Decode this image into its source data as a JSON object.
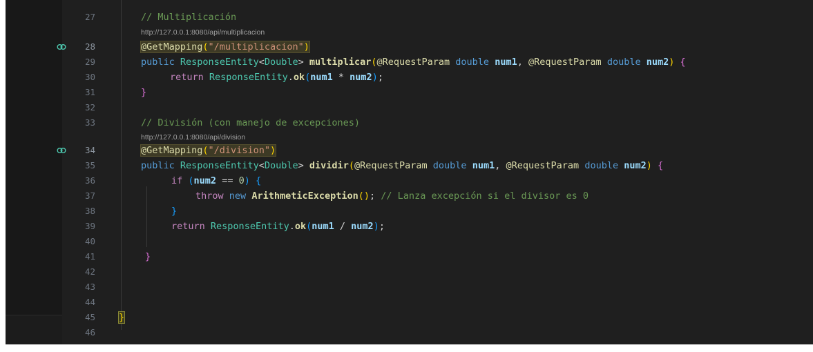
{
  "editor": {
    "codelens": {
      "multiplicacion": "http://127.0.0.1:8080/api/multiplicacion",
      "division": "http://127.0.0.1:8080/api/division"
    },
    "lines": [
      {
        "num": "27",
        "comment": "// Multiplicación"
      },
      {
        "num": "28",
        "annotation": "@GetMapping",
        "open": "(",
        "path": "\"/multiplicacion\"",
        "close": ")"
      },
      {
        "num": "29",
        "public": "public",
        "type": "ResponseEntity",
        "lt": "<",
        "generic": "Double",
        "gt": ">",
        "method": "multiplicar",
        "open": "(",
        "ann1": "@RequestParam",
        "double1": "double",
        "p1": "num1",
        "comma": ",",
        "ann2": "@RequestParam",
        "double2": "double",
        "p2": "num2",
        "close": ")",
        "brace": "{"
      },
      {
        "num": "30",
        "ret": "return",
        "type": "ResponseEntity",
        "dot": ".",
        "method": "ok",
        "open": "(",
        "a": "num1",
        "op": " * ",
        "b": "num2",
        "close": ")",
        "semi": ";"
      },
      {
        "num": "31",
        "brace": "}"
      },
      {
        "num": "32"
      },
      {
        "num": "33",
        "comment": "// División (con manejo de excepciones)"
      },
      {
        "num": "34",
        "annotation": "@GetMapping",
        "open": "(",
        "path": "\"/division\"",
        "close": ")"
      },
      {
        "num": "35",
        "public": "public",
        "type": "ResponseEntity",
        "lt": "<",
        "generic": "Double",
        "gt": ">",
        "method": "dividir",
        "open": "(",
        "ann1": "@RequestParam",
        "double1": "double",
        "p1": "num1",
        "comma": ",",
        "ann2": "@RequestParam",
        "double2": "double",
        "p2": "num2",
        "close": ")",
        "brace": "{"
      },
      {
        "num": "36",
        "kw": "if",
        "open": "(",
        "var": "num2",
        "op": " == ",
        "n": "0",
        "close": ")",
        "brace": "{"
      },
      {
        "num": "37",
        "throw": "throw",
        "new": "new",
        "ex": "ArithmeticException",
        "parens": "()",
        "semi": ";",
        "comment": "// Lanza excepción si el divisor es 0"
      },
      {
        "num": "38",
        "brace": "}"
      },
      {
        "num": "39",
        "ret": "return",
        "type": "ResponseEntity",
        "dot": ".",
        "method": "ok",
        "open": "(",
        "a": "num1",
        "op": " / ",
        "b": "num2",
        "close": ")",
        "semi": ";"
      },
      {
        "num": "40"
      },
      {
        "num": "41",
        "brace": "}"
      },
      {
        "num": "42"
      },
      {
        "num": "43"
      },
      {
        "num": "44"
      },
      {
        "num": "45",
        "brace": "}"
      },
      {
        "num": "46"
      }
    ]
  }
}
